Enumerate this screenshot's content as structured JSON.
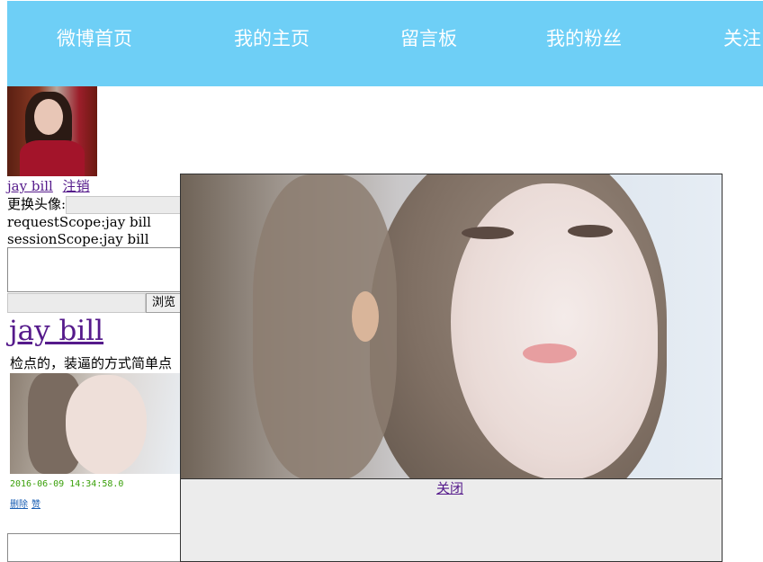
{
  "nav": {
    "items": [
      "微博首页",
      "我的主页",
      "留言板",
      "我的粉丝",
      "关注"
    ]
  },
  "user": {
    "name_link": "jay bill",
    "logout_link": "注销",
    "change_avatar_label": "更换头像:",
    "request_scope": "requestScope:jay bill",
    "session_scope": "sessionScope:jay bill",
    "browse_button": "浏览"
  },
  "post": {
    "author": "jay bill",
    "text": "检点的，装逼的方式简单点",
    "time": "2016-06-09 14:34:58.0",
    "delete_link": "删除",
    "like_link": "赞"
  },
  "modal": {
    "close_link": "关闭"
  },
  "colors": {
    "nav_bg": "#6ecff6",
    "link": "#551a8b",
    "timestamp": "#3aa00a"
  },
  "icons": {
    "avatar": "user-avatar-photo",
    "post_image": "post-photo",
    "modal_image": "enlarged-photo"
  }
}
